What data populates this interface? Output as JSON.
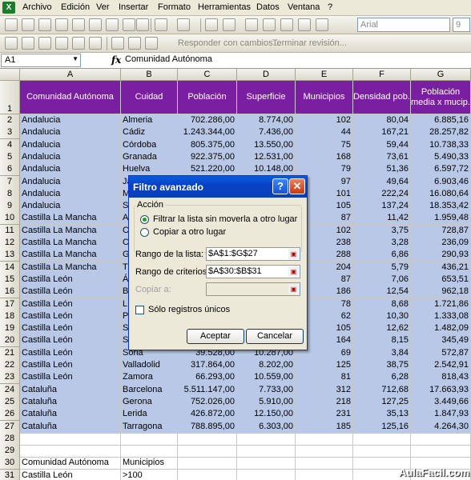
{
  "menu": [
    "Archivo",
    "Edición",
    "Ver",
    "Insertar",
    "Formato",
    "Herramientas",
    "Datos",
    "Ventana",
    "?"
  ],
  "toolbar": {
    "font_name": "Arial",
    "font_size": "9",
    "reply_changes": "Responder con cambios...",
    "end_review": "Terminar revisión..."
  },
  "formula_bar": {
    "name_box": "A1",
    "fx": "fx",
    "value": "Comunidad Autónoma"
  },
  "columns": [
    "A",
    "B",
    "C",
    "D",
    "E",
    "F",
    "G"
  ],
  "header_row": {
    "row": "1",
    "cells": [
      "Comunidad Autónoma",
      "Cuidad",
      "Población",
      "Superficie",
      "Municipios",
      "Densidad pob.",
      "Población media x mucip."
    ]
  },
  "rows": [
    {
      "n": "2",
      "a": "Andalucia",
      "b": "Almeria",
      "c": "702.286,00",
      "d": "8.774,00",
      "e": "102",
      "f": "80,04",
      "g": "6.885,16"
    },
    {
      "n": "3",
      "a": "Andalucia",
      "b": "Cádiz",
      "c": "1.243.344,00",
      "d": "7.436,00",
      "e": "44",
      "f": "167,21",
      "g": "28.257,82"
    },
    {
      "n": "4",
      "a": "Andalucia",
      "b": "Córdoba",
      "c": "805.375,00",
      "d": "13.550,00",
      "e": "75",
      "f": "59,44",
      "g": "10.738,33"
    },
    {
      "n": "5",
      "a": "Andalucia",
      "b": "Granada",
      "c": "922.375,00",
      "d": "12.531,00",
      "e": "168",
      "f": "73,61",
      "g": "5.490,33"
    },
    {
      "n": "6",
      "a": "Andalucia",
      "b": "Huelva",
      "c": "521.220,00",
      "d": "10.148,00",
      "e": "79",
      "f": "51,36",
      "g": "6.597,72"
    },
    {
      "n": "7",
      "a": "Andalucia",
      "b": "Ja",
      "c": "",
      "d": "",
      "e": "97",
      "f": "49,64",
      "g": "6.903,46"
    },
    {
      "n": "8",
      "a": "Andalucia",
      "b": "M",
      "c": "",
      "d": "",
      "e": "101",
      "f": "222,24",
      "g": "16.080,64"
    },
    {
      "n": "9",
      "a": "Andalucia",
      "b": "S",
      "c": "",
      "d": "",
      "e": "105",
      "f": "137,24",
      "g": "18.353,42"
    },
    {
      "n": "10",
      "a": "Castilla La Mancha",
      "b": "A",
      "c": "",
      "d": "",
      "e": "87",
      "f": "11,42",
      "g": "1.959,48"
    },
    {
      "n": "11",
      "a": "Castilla La Mancha",
      "b": "C",
      "c": "",
      "d": "",
      "e": "102",
      "f": "3,75",
      "g": "728,87"
    },
    {
      "n": "12",
      "a": "Castilla La Mancha",
      "b": "C",
      "c": "",
      "d": "",
      "e": "238",
      "f": "3,28",
      "g": "236,09"
    },
    {
      "n": "13",
      "a": "Castilla La Mancha",
      "b": "G",
      "c": "",
      "d": "",
      "e": "288",
      "f": "6,86",
      "g": "290,93"
    },
    {
      "n": "14",
      "a": "Castilla La Mancha",
      "b": "T",
      "c": "",
      "d": "",
      "e": "204",
      "f": "5,79",
      "g": "436,21"
    },
    {
      "n": "15",
      "a": "Castilla León",
      "b": "Á",
      "c": "",
      "d": "",
      "e": "87",
      "f": "7,06",
      "g": "653,51"
    },
    {
      "n": "16",
      "a": "Castilla León",
      "b": "B",
      "c": "",
      "d": "",
      "e": "186",
      "f": "12,54",
      "g": "962,18"
    },
    {
      "n": "17",
      "a": "Castilla León",
      "b": "L",
      "c": "",
      "d": "",
      "e": "78",
      "f": "8,68",
      "g": "1.721,86"
    },
    {
      "n": "18",
      "a": "Castilla León",
      "b": "P",
      "c": "",
      "d": "",
      "e": "62",
      "f": "10,30",
      "g": "1.333,08"
    },
    {
      "n": "19",
      "a": "Castilla León",
      "b": "S",
      "c": "",
      "d": "",
      "e": "105",
      "f": "12,62",
      "g": "1.482,09"
    },
    {
      "n": "20",
      "a": "Castilla León",
      "b": "S",
      "c": "",
      "d": "",
      "e": "164",
      "f": "8,15",
      "g": "345,49"
    },
    {
      "n": "21",
      "a": "Castilla León",
      "b": "Soria",
      "c": "39.528,00",
      "d": "10.287,00",
      "e": "69",
      "f": "3,84",
      "g": "572,87"
    },
    {
      "n": "22",
      "a": "Castilla León",
      "b": "Valladolid",
      "c": "317.864,00",
      "d": "8.202,00",
      "e": "125",
      "f": "38,75",
      "g": "2.542,91"
    },
    {
      "n": "23",
      "a": "Castilla León",
      "b": "Zamora",
      "c": "66.293,00",
      "d": "10.559,00",
      "e": "81",
      "f": "6,28",
      "g": "818,43"
    },
    {
      "n": "24",
      "a": "Cataluña",
      "b": "Barcelona",
      "c": "5.511.147,00",
      "d": "7.733,00",
      "e": "312",
      "f": "712,68",
      "g": "17.663,93"
    },
    {
      "n": "25",
      "a": "Cataluña",
      "b": "Gerona",
      "c": "752.026,00",
      "d": "5.910,00",
      "e": "218",
      "f": "127,25",
      "g": "3.449,66"
    },
    {
      "n": "26",
      "a": "Cataluña",
      "b": "Lerida",
      "c": "426.872,00",
      "d": "12.150,00",
      "e": "231",
      "f": "35,13",
      "g": "1.847,93"
    },
    {
      "n": "27",
      "a": "Cataluña",
      "b": "Tarragona",
      "c": "788.895,00",
      "d": "6.303,00",
      "e": "185",
      "f": "125,16",
      "g": "4.264,30"
    }
  ],
  "criteria_rows": [
    {
      "n": "28",
      "a": "",
      "b": ""
    },
    {
      "n": "29",
      "a": "",
      "b": ""
    },
    {
      "n": "30",
      "a": "Comunidad Autónoma",
      "b": "Municipios"
    },
    {
      "n": "31",
      "a": "Castilla León",
      "b": ">100"
    }
  ],
  "dialog": {
    "title": "Filtro avanzado",
    "help": "?",
    "close": "✕",
    "group_label": "Acción",
    "radio_filter": "Filtrar la lista sin moverla a otro lugar",
    "radio_copy": "Copiar a otro lugar",
    "list_range_label": "Rango de la lista:",
    "list_range_value": "$A$1:$G$27",
    "criteria_range_label": "Rango de criterios:",
    "criteria_range_value": "$A$30:$B$31",
    "copy_to_label": "Copiar a:",
    "unique_label": "Sólo registros únicos",
    "ok": "Aceptar",
    "cancel": "Cancelar"
  },
  "watermark": "AulaFacil.com"
}
